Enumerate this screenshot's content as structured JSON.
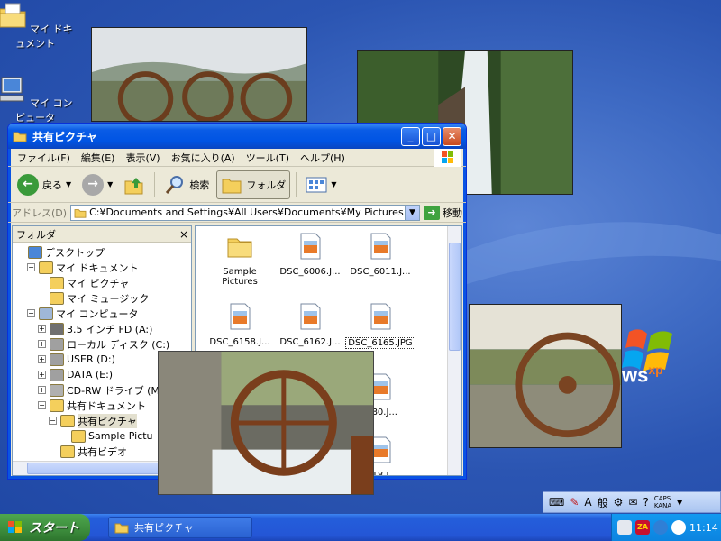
{
  "desktop": {
    "icons": [
      {
        "label": "マイ ドキュメント",
        "icon": "my-documents-icon"
      },
      {
        "label": "マイ コンピュータ",
        "icon": "my-computer-icon"
      }
    ]
  },
  "window": {
    "title": "共有ピクチャ",
    "controls": {
      "minimize": "_",
      "maximize": "□",
      "close": "✕"
    },
    "menu": [
      "ファイル(F)",
      "編集(E)",
      "表示(V)",
      "お気に入り(A)",
      "ツール(T)",
      "ヘルプ(H)"
    ],
    "toolbar": {
      "back": "戻る",
      "search": "検索",
      "folders": "フォルダ"
    },
    "address": {
      "label": "アドレス(D)",
      "value": "C:¥Documents and Settings¥All Users¥Documents¥My Pictures",
      "go": "移動"
    },
    "folder_pane": {
      "title": "フォルダ",
      "close": "×",
      "tree": [
        {
          "label": "デスクトップ",
          "level": 0,
          "toggle": "",
          "icon": "desktop-icon"
        },
        {
          "label": "マイ ドキュメント",
          "level": 1,
          "toggle": "−",
          "icon": "my-documents-icon"
        },
        {
          "label": "マイ ピクチャ",
          "level": 2,
          "toggle": "",
          "icon": "my-pictures-icon"
        },
        {
          "label": "マイ ミュージック",
          "level": 2,
          "toggle": "",
          "icon": "my-music-icon"
        },
        {
          "label": "マイ コンピュータ",
          "level": 1,
          "toggle": "−",
          "icon": "my-computer-icon"
        },
        {
          "label": "3.5 インチ FD (A:)",
          "level": 2,
          "toggle": "+",
          "icon": "floppy-icon"
        },
        {
          "label": "ローカル ディスク (C:)",
          "level": 2,
          "toggle": "+",
          "icon": "drive-icon"
        },
        {
          "label": "USER (D:)",
          "level": 2,
          "toggle": "+",
          "icon": "drive-icon"
        },
        {
          "label": "DATA (E:)",
          "level": 2,
          "toggle": "+",
          "icon": "drive-icon"
        },
        {
          "label": "CD-RW ドライブ (M:)",
          "level": 2,
          "toggle": "+",
          "icon": "cd-drive-icon"
        },
        {
          "label": "共有ドキュメント",
          "level": 2,
          "toggle": "−",
          "icon": "folder-icon"
        },
        {
          "label": "共有ピクチャ",
          "level": 3,
          "toggle": "−",
          "icon": "folder-icon",
          "selected": true
        },
        {
          "label": "Sample Pictu",
          "level": 4,
          "toggle": "",
          "icon": "folder-icon"
        },
        {
          "label": "共有ビデオ",
          "level": 3,
          "toggle": "",
          "icon": "folder-icon"
        }
      ]
    },
    "files": [
      {
        "name": "Sample Pictures",
        "type": "folder"
      },
      {
        "name": "DSC_6006.J...",
        "type": "image"
      },
      {
        "name": "DSC_6011.J...",
        "type": "image"
      },
      {
        "name": "DSC_6158.J...",
        "type": "image"
      },
      {
        "name": "DSC_6162.J...",
        "type": "image"
      },
      {
        "name": "DSC_6165.JPG",
        "type": "image",
        "selected": true
      },
      {
        "name": "...80.J...",
        "type": "image"
      },
      {
        "name": "...18.J...",
        "type": "image"
      }
    ]
  },
  "xp_logo": {
    "text": "ws",
    "sup": "xp"
  },
  "langbar": {
    "ime": "A",
    "mode": "般",
    "caps": "CAPS",
    "kana": "KANA"
  },
  "taskbar": {
    "start_label": "スタート",
    "task_label": "共有ピクチャ",
    "clock": "11:14",
    "tray_za": "ZA"
  }
}
